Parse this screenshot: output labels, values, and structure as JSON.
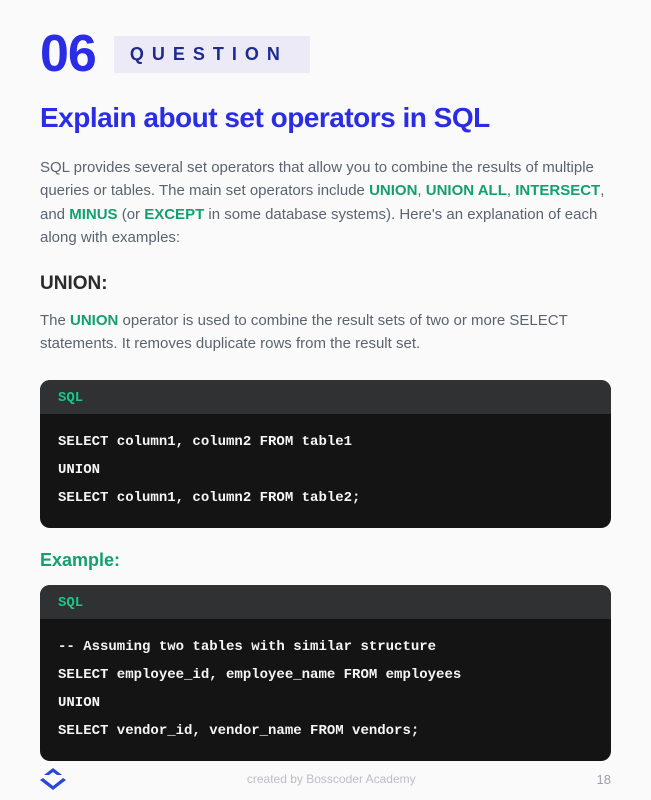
{
  "header": {
    "number": "06",
    "label": "QUESTION"
  },
  "title": "Explain about set operators in SQL",
  "intro": {
    "pre1": "SQL provides several set operators that allow you to combine the results of multiple queries or tables. The main set operators include ",
    "kw1": "UNION",
    "sep1": ", ",
    "kw2": "UNION ALL",
    "sep2": ", ",
    "kw3": "INTERSECT",
    "sep3": ", and ",
    "kw4": "MINUS",
    "sep4": " (or ",
    "kw5": "EXCEPT",
    "post": " in some database systems). Here's an explanation of each along with examples:"
  },
  "section1": {
    "heading": "UNION:",
    "desc_pre": "The ",
    "desc_kw": "UNION",
    "desc_post": " operator is used to combine the result sets of two or more SELECT statements. It removes duplicate rows from the result set."
  },
  "code1": {
    "lang": "SQL",
    "body": "SELECT column1, column2 FROM table1\nUNION\nSELECT column1, column2 FROM table2;"
  },
  "example_label": "Example:",
  "code2": {
    "lang": "SQL",
    "body": "-- Assuming two tables with similar structure\nSELECT employee_id, employee_name FROM employees\nUNION\nSELECT vendor_id, vendor_name FROM vendors;"
  },
  "footer": {
    "credit": "created by Bosscoder Academy",
    "page": "18"
  }
}
